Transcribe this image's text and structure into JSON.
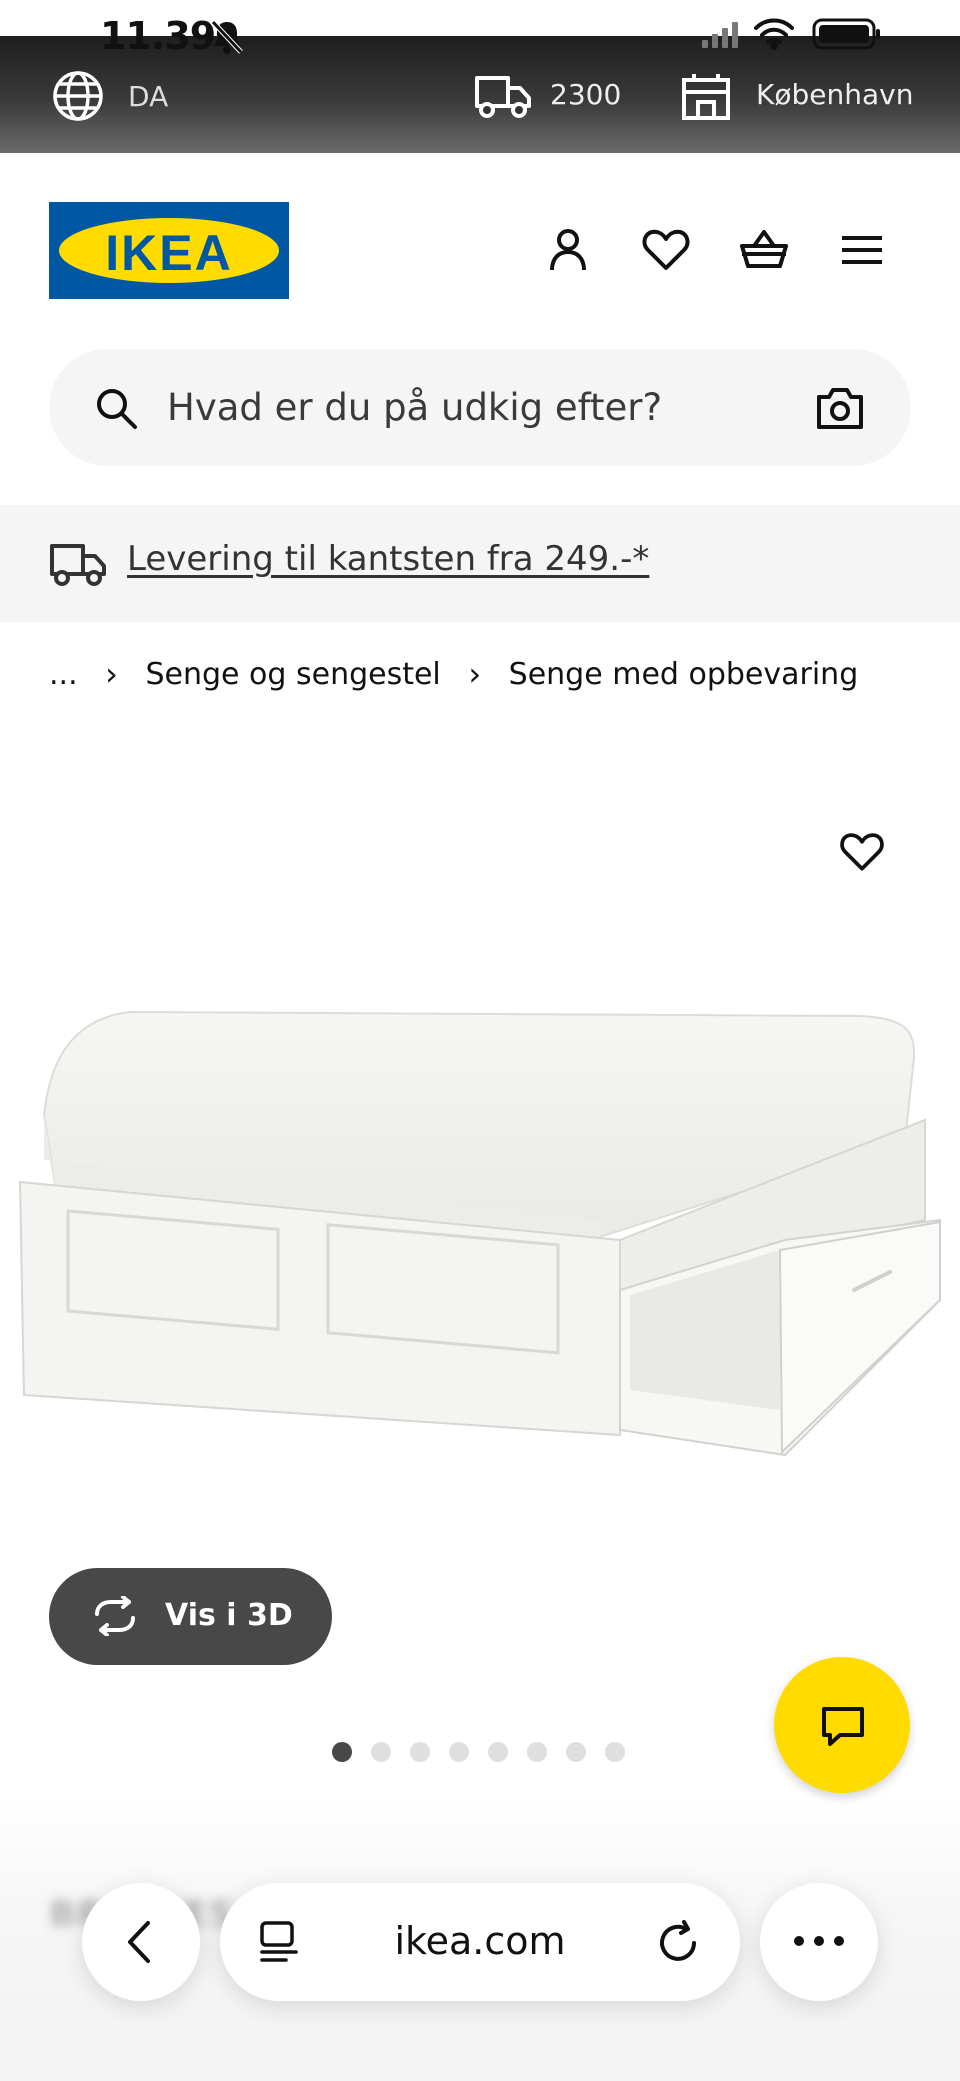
{
  "status_bar": {
    "time": "11.39"
  },
  "top_bar": {
    "language": "DA",
    "postcode": "2300",
    "store": "København"
  },
  "header": {
    "logo_text": "IKEA",
    "icons": [
      "account-icon",
      "heart-icon",
      "cart-icon",
      "menu-icon"
    ]
  },
  "search": {
    "placeholder": "Hvad er du på udkig efter?"
  },
  "banner": {
    "link": "Levering til kantsten fra 249.-*"
  },
  "breadcrumb": {
    "ellipsis": "...",
    "items": [
      "Senge og sengestel",
      "Senge med opbevaring"
    ]
  },
  "product": {
    "name_partial": "BRIMNES",
    "view3d_label": "Vis i 3D",
    "image_count": 8,
    "active_image": 1
  },
  "browser": {
    "url": "ikea.com"
  },
  "colors": {
    "ikea_blue": "#0058a3",
    "ikea_yellow": "#ffdb00",
    "dark_button": "#484848"
  }
}
